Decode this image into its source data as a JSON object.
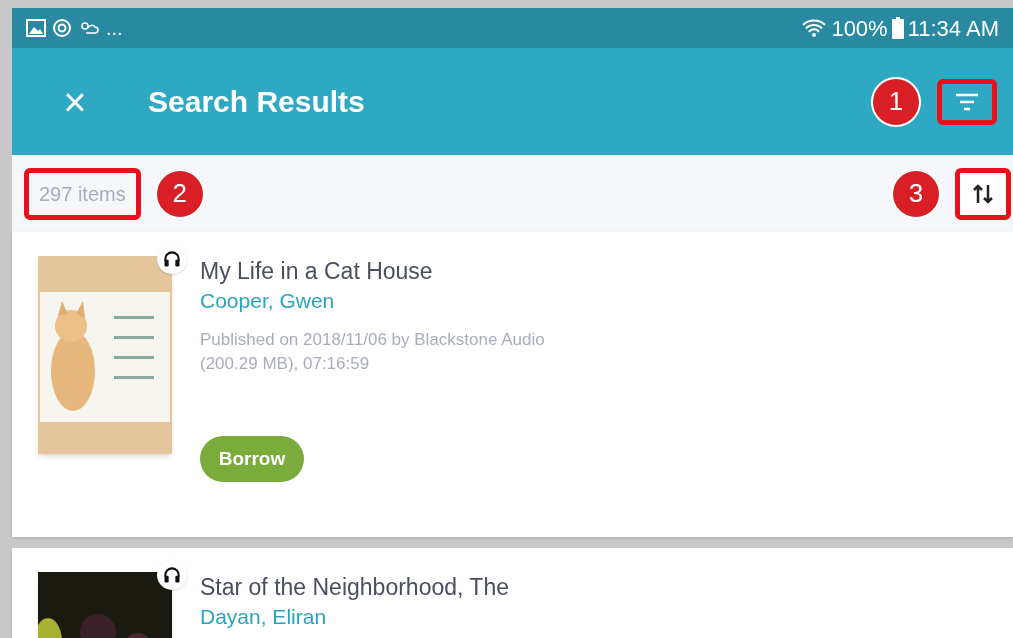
{
  "status_bar": {
    "notifications_more": "...",
    "battery": "100%",
    "time": "11:34 AM"
  },
  "header": {
    "close_icon": "×",
    "title": "Search Results"
  },
  "results": {
    "count": "297 items"
  },
  "callouts": [
    {
      "number": "1"
    },
    {
      "number": "2"
    },
    {
      "number": "3"
    }
  ],
  "books": [
    {
      "kind": "audiobook",
      "title": "My Life in a Cat House",
      "author": "Cooper, Gwen",
      "details": [
        "Published on 2018/11/06 by Blackstone Audio",
        "(200.29 MB), 07:16:59"
      ],
      "button": "Borrow"
    },
    {
      "kind": "audiobook",
      "title": "Star of the Neighborhood, The",
      "author": "Dayan, Eliran"
    }
  ]
}
